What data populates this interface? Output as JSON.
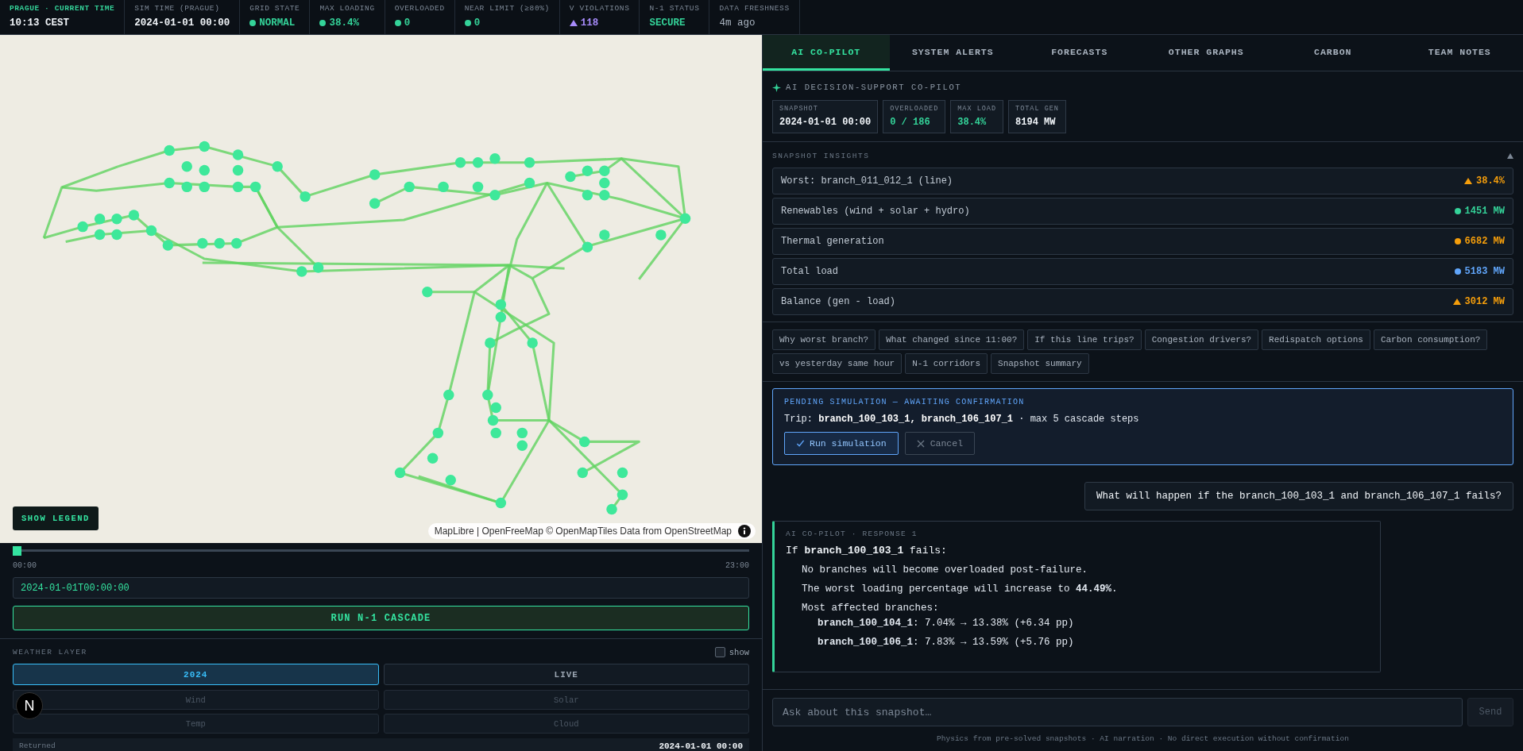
{
  "top_bar": {
    "items": [
      {
        "label": "PRAGUE · CURRENT TIME",
        "value": "10:13 CEST",
        "kind": "clock"
      },
      {
        "label": "SIM TIME (PRAGUE)",
        "value": "2024-01-01 00:00",
        "kind": "plain"
      },
      {
        "label": "GRID STATE",
        "value": "NORMAL",
        "kind": "dot",
        "color": "#34d399"
      },
      {
        "label": "MAX LOADING",
        "value": "38.4%",
        "kind": "dot",
        "color": "#34d399"
      },
      {
        "label": "OVERLOADED",
        "value": "0",
        "kind": "dot",
        "color": "#34d399"
      },
      {
        "label": "NEAR LIMIT (≥80%)",
        "value": "0",
        "kind": "dot",
        "color": "#34d399"
      },
      {
        "label": "V VIOLATIONS",
        "value": "118",
        "kind": "triangle",
        "color": "#a78bfa"
      },
      {
        "label": "N-1 STATUS",
        "value": "SECURE",
        "kind": "status",
        "color": "#34d399"
      },
      {
        "label": "DATA FRESHNESS",
        "value": "4m ago",
        "kind": "muted"
      }
    ]
  },
  "map": {
    "legend_button": "SHOW LEGEND",
    "attribution": "MapLibre | OpenFreeMap © OpenMapTiles Data from OpenStreetMap"
  },
  "timeline": {
    "level": 0,
    "start": "00:00",
    "end": "23:00"
  },
  "timestamp_field": {
    "value": "2024-01-01T00:00:00"
  },
  "cascade_button": "RUN N-1 CASCADE",
  "weather_layer": {
    "title": "WEATHER LAYER",
    "show": {
      "label": "show",
      "checked": false
    },
    "modes": [
      {
        "label": "2024",
        "selected": true
      },
      {
        "label": "LIVE",
        "selected": false
      }
    ],
    "variables": [
      {
        "label": "Wind",
        "disabled": true
      },
      {
        "label": "Solar",
        "disabled": true
      },
      {
        "label": "Temp",
        "disabled": true
      },
      {
        "label": "Cloud",
        "disabled": true
      }
    ],
    "returned": {
      "label": "Returned",
      "value": "2024-01-01 00:00"
    }
  },
  "dev_badge": "N",
  "tabs": [
    {
      "label": "AI CO-PILOT",
      "selected": true
    },
    {
      "label": "SYSTEM ALERTS",
      "selected": false
    },
    {
      "label": "FORECASTS",
      "selected": false
    },
    {
      "label": "OTHER GRAPHS",
      "selected": false
    },
    {
      "label": "CARBON",
      "selected": false
    },
    {
      "label": "TEAM NOTES",
      "selected": false
    }
  ],
  "copilot": {
    "title": "AI DECISION-SUPPORT CO-PILOT",
    "stats": [
      {
        "label": "SNAPSHOT",
        "value": "2024-01-01 00:00"
      },
      {
        "label": "OVERLOADED",
        "value": "0 / 186",
        "color": "#34d399"
      },
      {
        "label": "MAX LOAD",
        "value": "38.4%",
        "color": "#34d399"
      },
      {
        "label": "TOTAL GEN",
        "value": "8194 MW"
      }
    ],
    "insights": {
      "title": "SNAPSHOT INSIGHTS",
      "expanded": true,
      "rows": [
        {
          "label": "Worst: branch_011_012_1 (line)",
          "value": "38.4%",
          "kind": "triangle",
          "color": "#f59e0b"
        },
        {
          "label": "Renewables (wind + solar + hydro)",
          "value": "1451 MW",
          "kind": "dot",
          "color": "#34d399"
        },
        {
          "label": "Thermal generation",
          "value": "6682 MW",
          "kind": "dot",
          "color": "#f59e0b"
        },
        {
          "label": "Total load",
          "value": "5183 MW",
          "kind": "dot",
          "color": "#60a5fa"
        },
        {
          "label": "Balance (gen - load)",
          "value": "3012 MW",
          "kind": "triangle",
          "color": "#f59e0b"
        }
      ]
    },
    "suggestions": [
      "Why worst branch?",
      "What changed since 11:00?",
      "If this line trips?",
      "Congestion drivers?",
      "Redispatch options",
      "Carbon consumption?",
      "vs yesterday same hour",
      "N-1 corridors",
      "Snapshot summary"
    ],
    "pending": {
      "title": "PENDING SIMULATION — AWAITING CONFIRMATION",
      "text": "Trip: **branch_100_103_1, branch_106_107_1** · max 5 cascade steps",
      "confirm": "Run simulation",
      "cancel": "Cancel"
    },
    "messages": [
      {
        "kind": "user",
        "text": "What will happen if the branch_100_103_1 and branch_106_107_1 fails?"
      },
      {
        "kind": "assistant",
        "label": "AI CO-PILOT · RESPONSE 1",
        "heading": "If **branch_100_103_1** fails:",
        "points": [
          "No branches will become overloaded post-failure.",
          "The worst loading percentage will increase to **44.49%**."
        ],
        "list_title": "Most affected branches:",
        "list": [
          "**branch_100_104_1**: 7.04% → 13.38% (+6.34 pp)",
          "**branch_100_106_1**: 7.83% → 13.59% (+5.76 pp)"
        ]
      }
    ],
    "input": {
      "placeholder": "Ask about this snapshot…"
    },
    "send": {
      "label": "Send",
      "disabled": true
    },
    "footer": "Physics from pre-solved snapshots · AI narration · No direct execution without confirmation"
  }
}
